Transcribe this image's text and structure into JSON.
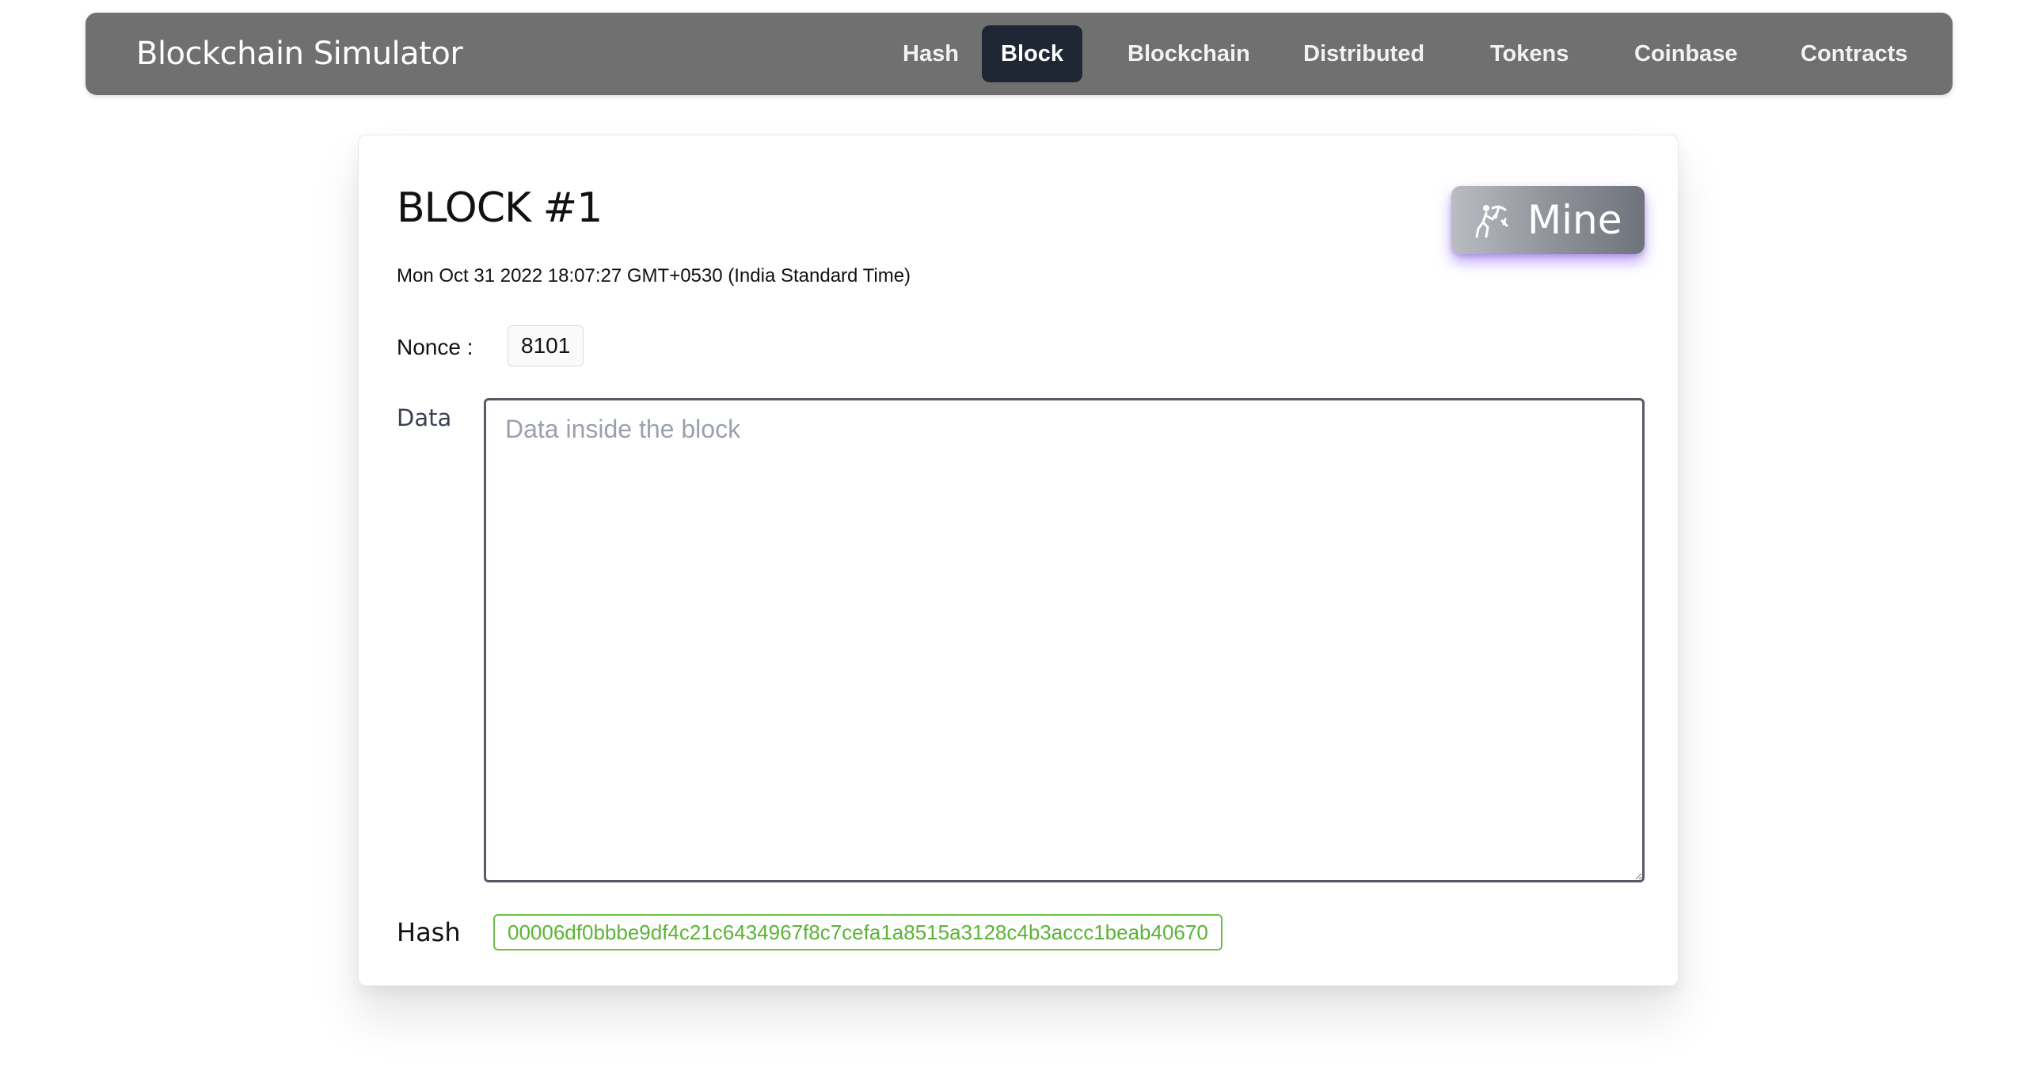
{
  "app": {
    "brand": "Blockchain Simulator"
  },
  "nav": {
    "items": [
      {
        "label": "Hash",
        "active": false
      },
      {
        "label": "Block",
        "active": true
      },
      {
        "label": "Blockchain",
        "active": false
      },
      {
        "label": "Distributed",
        "active": false
      },
      {
        "label": "Tokens",
        "active": false
      },
      {
        "label": "Coinbase",
        "active": false
      },
      {
        "label": "Contracts",
        "active": false
      }
    ]
  },
  "block": {
    "title": "BLOCK #1",
    "timestamp": "Mon Oct 31 2022 18:07:27 GMT+0530 (India Standard Time)",
    "mine_label": "Mine",
    "mine_icon": "miner-icon",
    "nonce_label": "Nonce :",
    "nonce_value": "8101",
    "data_label": "Data",
    "data_value": "",
    "data_placeholder": "Data inside the block",
    "hash_label": "Hash",
    "hash_value": "00006df0bbbe9df4c21c6434967f8c7cefa1a8515a3128c4b3accc1beab40670"
  },
  "colors": {
    "navbar_bg": "#707070",
    "nav_active_bg": "#1f2634",
    "hash_valid": "#5cb335",
    "mine_glow": "#8b5cf6"
  }
}
